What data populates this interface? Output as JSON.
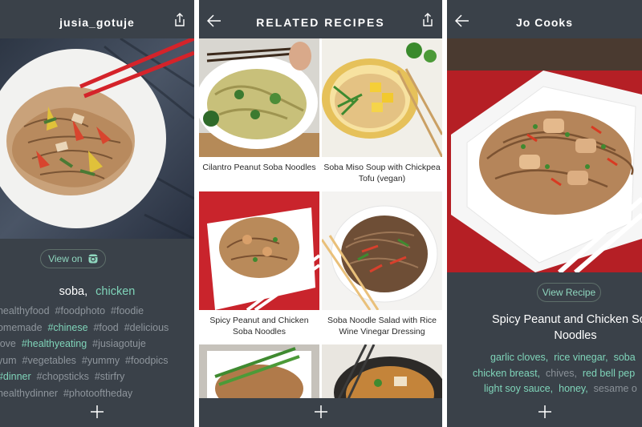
{
  "screen1": {
    "title": "jusia_gotuje",
    "view_on_label": "View on",
    "tags_primary": [
      "soba,",
      "chicken"
    ],
    "hashtag_lines": [
      [
        {
          "t": "#healthyfood  #foodphoto  #foodie",
          "h": false
        }
      ],
      [
        {
          "t": "homemade  ",
          "h": false
        },
        {
          "t": "#chinese",
          "h": true
        },
        {
          "t": "  #food  #delicious",
          "h": false
        }
      ],
      [
        {
          "t": "#love  ",
          "h": false
        },
        {
          "t": "#healthyeating",
          "h": true
        },
        {
          "t": "  #jusiagotuje",
          "h": false
        }
      ],
      [
        {
          "t": "#yum  #vegetables  #yummy  #foodpics",
          "h": false
        }
      ],
      [
        {
          "t": "#",
          "h": false
        },
        {
          "t": "#dinner",
          "h": true
        },
        {
          "t": "  #chopsticks  #stirfry",
          "h": false
        }
      ],
      [
        {
          "t": "#healthydinner  #photooftheday",
          "h": false
        }
      ]
    ]
  },
  "screen2": {
    "title": "RELATED RECIPES",
    "recipes": [
      {
        "name": "Cilantro Peanut Soba Noodles"
      },
      {
        "name": "Soba Miso Soup with Chickpea Tofu (vegan)"
      },
      {
        "name": "Spicy Peanut and Chicken Soba Noodles"
      },
      {
        "name": "Soba Noodle Salad with Rice Wine Vinegar Dressing"
      }
    ]
  },
  "screen3": {
    "title": "Jo Cooks",
    "view_recipe_label": "View Recipe",
    "recipe_title": "Spicy Peanut and Chicken Soba Noodles",
    "ingredient_lines": [
      [
        {
          "t": "garlic cloves,",
          "g": true
        },
        {
          "t": "  ",
          "g": false
        },
        {
          "t": "rice vinegar,",
          "g": true
        },
        {
          "t": "  ",
          "g": false
        },
        {
          "t": "soba",
          "g": true
        }
      ],
      [
        {
          "t": "chicken breast,",
          "g": true
        },
        {
          "t": "  chives,  ",
          "g": false
        },
        {
          "t": "red bell pep",
          "g": true
        }
      ],
      [
        {
          "t": "light soy sauce,",
          "g": true
        },
        {
          "t": "  ",
          "g": false
        },
        {
          "t": "honey,",
          "g": true
        },
        {
          "t": "  sesame o",
          "g": false
        }
      ]
    ]
  },
  "colors": {
    "bar": "#3a4149",
    "accent": "#7fd4b9",
    "muted_text": "#8e959c"
  },
  "icons": [
    "share-icon",
    "back-icon",
    "plus-icon",
    "instagram-icon"
  ]
}
